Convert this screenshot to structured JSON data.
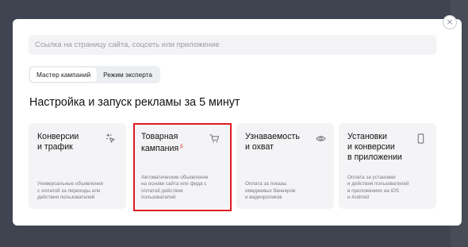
{
  "modal": {
    "search_placeholder": "Ссылка на страницу сайта, соцсеть или приложение",
    "close_symbol": "×"
  },
  "mode_switch": {
    "options": [
      {
        "label": "Мастер кампаний",
        "active": true
      },
      {
        "label": "Режим эксперта",
        "active": false
      }
    ]
  },
  "heading": "Настройка и запуск рекламы за 5 минут",
  "cards": [
    {
      "title_lines": [
        "Конверсии",
        "и трафик"
      ],
      "icon": "sparkle-cursor-icon",
      "desc_lines": [
        "Универсальные объявления",
        "с оплатой за переходы или",
        "действия пользователей"
      ],
      "highlighted": false
    },
    {
      "title_lines": [
        "Товарная",
        "кампания"
      ],
      "badge": "β",
      "icon": "cart-icon",
      "desc_lines": [
        "Автоматические объявления",
        "на основе сайта или фида с",
        "оплатой действия",
        "пользователей"
      ],
      "highlighted": true
    },
    {
      "title_lines": [
        "Узнаваемость",
        "и охват"
      ],
      "icon": "eye-icon",
      "desc_lines": [
        "Оплата за показы",
        "имиджевых баннеров",
        "и видеороликов"
      ],
      "highlighted": false
    },
    {
      "title_lines": [
        "Установки",
        "и конверсии",
        "в приложении"
      ],
      "icon": "phone-icon",
      "desc_lines": [
        "Оплата за установки",
        "и действия пользователей",
        "в приложениях на iOS",
        "и Android"
      ],
      "highlighted": false
    }
  ],
  "colors": {
    "overlay": "#3f4450",
    "card_bg": "#f4f4f6",
    "highlight": "#e11b22",
    "beta": "#e0302a"
  }
}
